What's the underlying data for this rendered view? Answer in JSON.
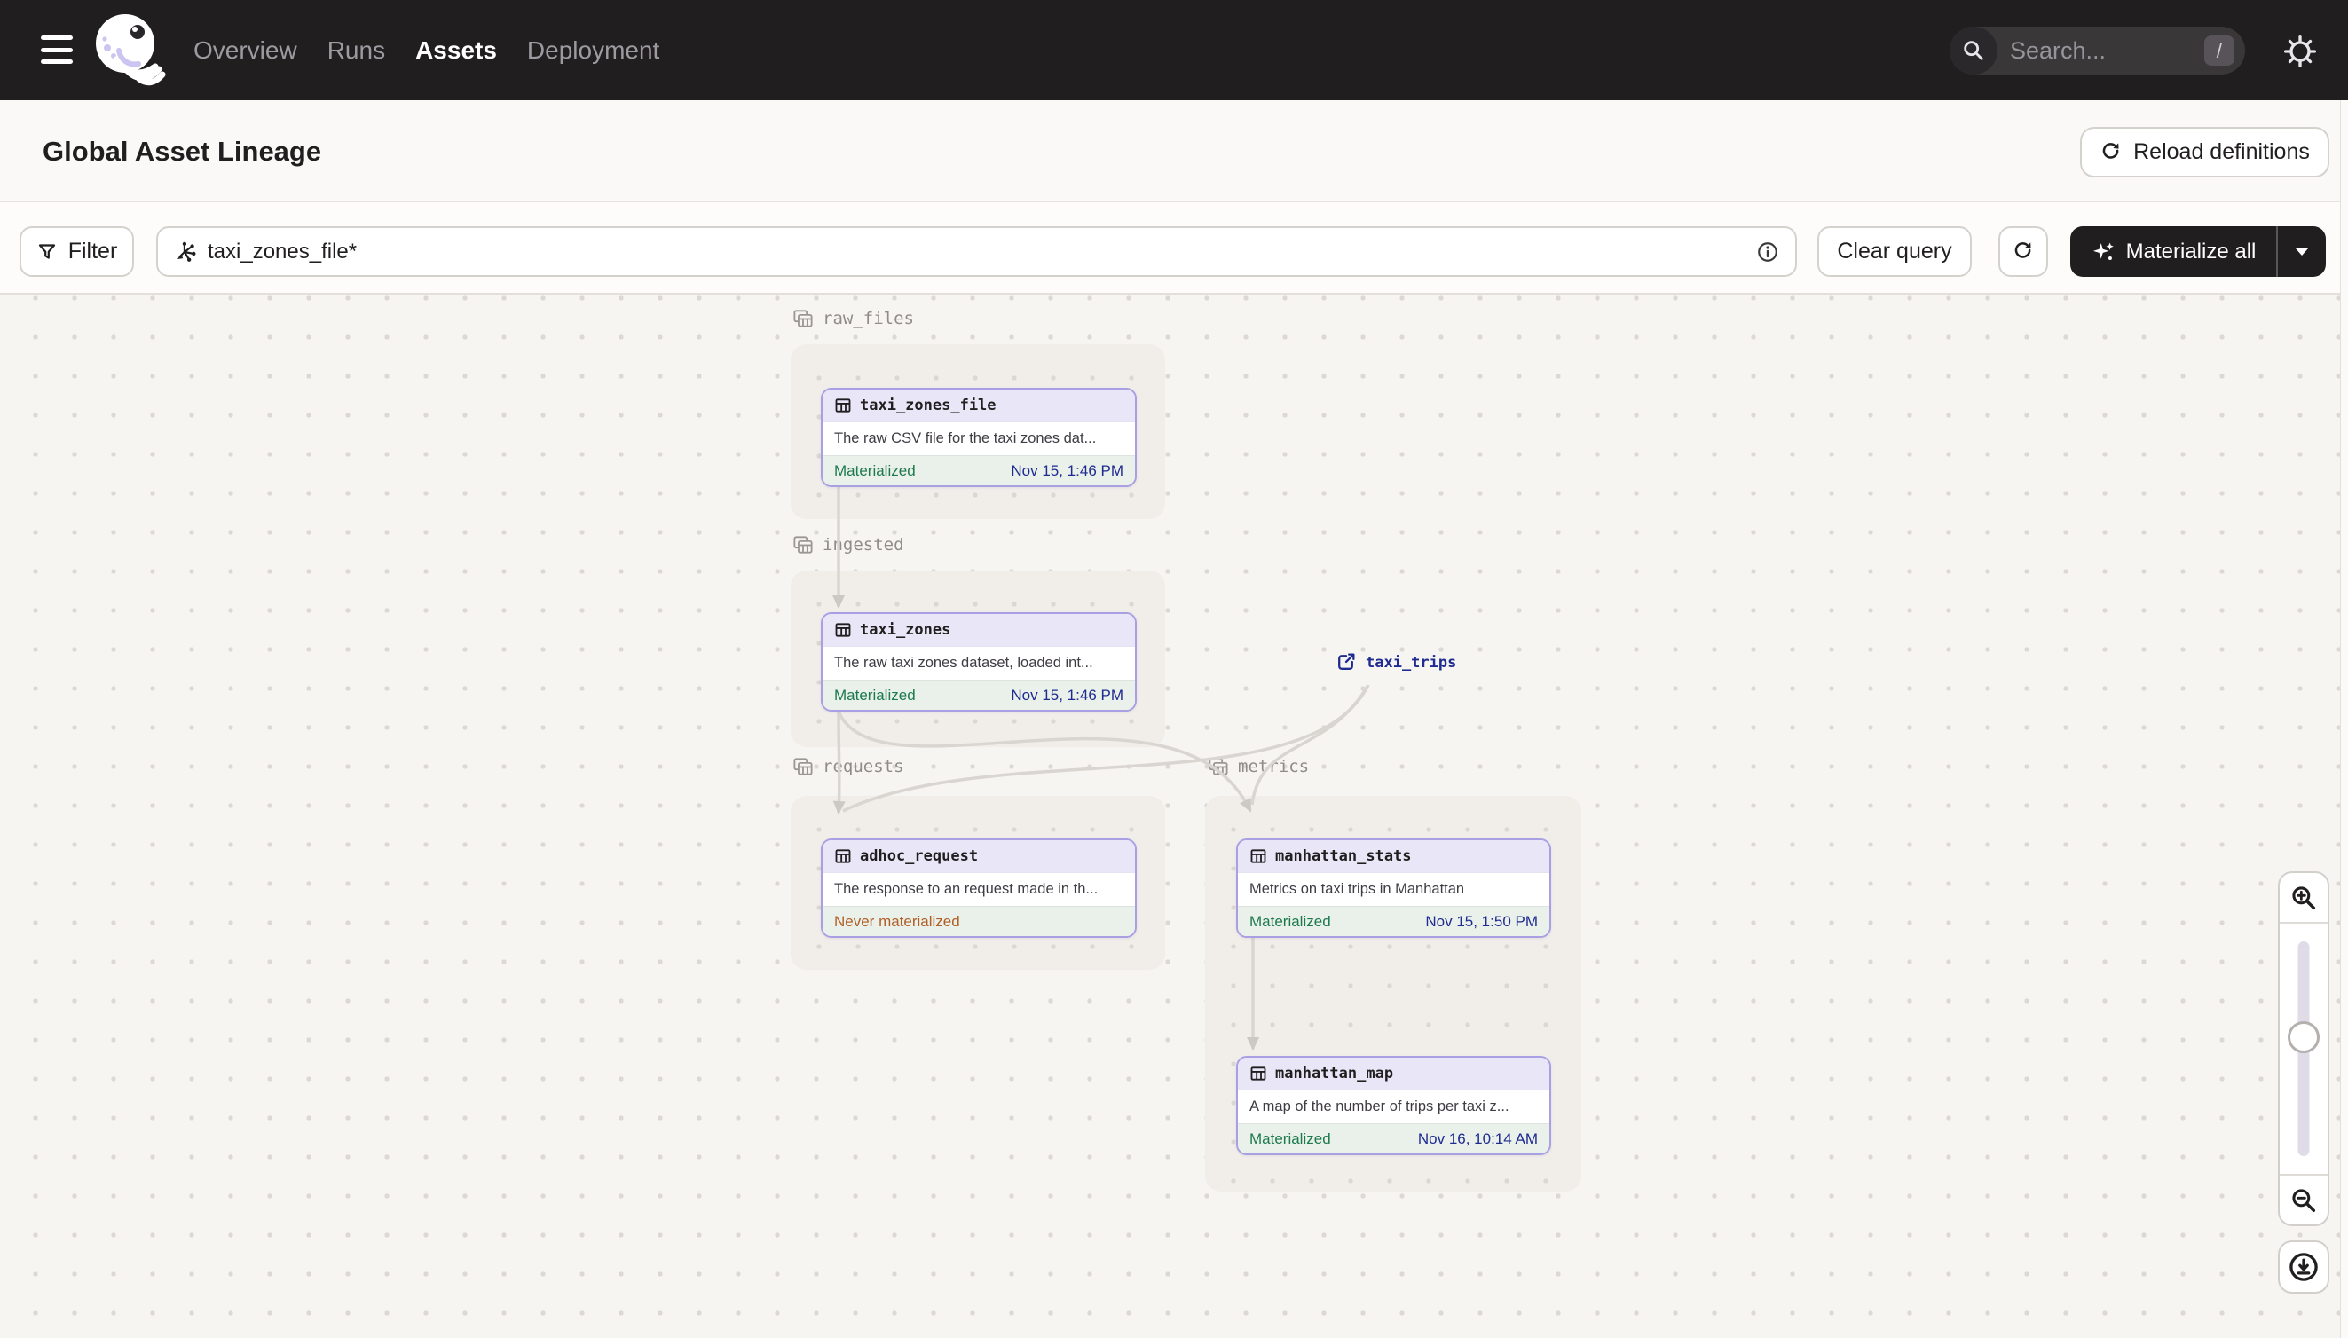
{
  "topbar": {
    "nav": [
      {
        "label": "Overview"
      },
      {
        "label": "Runs"
      },
      {
        "label": "Assets"
      },
      {
        "label": "Deployment"
      }
    ],
    "active_nav": "Assets",
    "search_placeholder": "Search...",
    "search_shortcut": "/"
  },
  "header": {
    "title": "Global Asset Lineage",
    "reload_button": "Reload definitions"
  },
  "toolbar": {
    "filter_button": "Filter",
    "query_value": "taxi_zones_file*",
    "clear_button": "Clear query",
    "materialize_button": "Materialize all"
  },
  "graph": {
    "groups": [
      {
        "name": "raw_files",
        "assets": [
          {
            "name": "taxi_zones_file",
            "description": "The raw CSV file for the taxi zones dat...",
            "status": "Materialized",
            "timestamp": "Nov 15, 1:46 PM"
          }
        ]
      },
      {
        "name": "ingested",
        "assets": [
          {
            "name": "taxi_zones",
            "description": "The raw taxi zones dataset, loaded int...",
            "status": "Materialized",
            "timestamp": "Nov 15, 1:46 PM"
          }
        ]
      },
      {
        "name": "requests",
        "assets": [
          {
            "name": "adhoc_request",
            "description": "The response to an request made in th...",
            "status": "Never materialized",
            "timestamp": ""
          }
        ]
      },
      {
        "name": "metrics",
        "assets": [
          {
            "name": "manhattan_stats",
            "description": "Metrics on taxi trips in Manhattan",
            "status": "Materialized",
            "timestamp": "Nov 15, 1:50 PM"
          },
          {
            "name": "manhattan_map",
            "description": "A map of the number of trips per taxi z...",
            "status": "Materialized",
            "timestamp": "Nov 16, 10:14 AM"
          }
        ]
      }
    ],
    "external_assets": [
      {
        "name": "taxi_trips"
      }
    ]
  },
  "colors": {
    "topbar_bg": "#211e1f",
    "canvas_bg": "#f7f5f2",
    "node_border": "#a9a0e4",
    "node_header_bg": "#e9e6f8",
    "node_footer_bg": "#eaf0ea",
    "materialized_green": "#1d7a4d",
    "never_materialized_orange": "#b05f24",
    "timestamp_navy": "#1e2b90",
    "external_asset_navy": "#1e2b90",
    "edge_gray": "#d9d5d1"
  }
}
